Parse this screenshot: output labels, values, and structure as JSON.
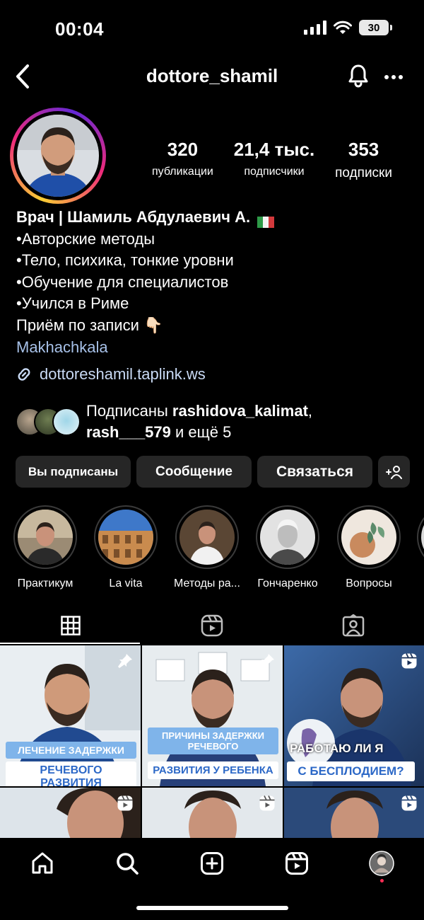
{
  "status_bar": {
    "time": "00:04",
    "battery": "30"
  },
  "header": {
    "username": "dottore_shamil"
  },
  "stats": {
    "posts": {
      "value": "320",
      "label": "публикации"
    },
    "followers": {
      "value": "21,4 тыс.",
      "label": "подписчики"
    },
    "following": {
      "value": "353",
      "label": "подписки"
    }
  },
  "bio": {
    "name": "Врач | Шамиль Абдулаевич А.",
    "lines": [
      "•Авторские методы",
      "•Тело, психика, тонкие уровни",
      "•Обучение для специалистов",
      "•Учился в Риме",
      "Приём по записи 👇🏻"
    ],
    "location": "Makhachkala",
    "link": "dottoreshamil.taplink.ws"
  },
  "followed_by": {
    "prefix": "Подписаны ",
    "user1": "rashidova_kalimat",
    "comma": ",",
    "user2": "rash___579",
    "suffix": " и ещё 5"
  },
  "buttons": {
    "following": "Вы подписаны",
    "message": "Сообщение",
    "contact": "Связаться",
    "add_user": "+👤"
  },
  "highlights": [
    {
      "label": "Практикум"
    },
    {
      "label": "La vita"
    },
    {
      "label": "Методы ра..."
    },
    {
      "label": "Гончаренко"
    },
    {
      "label": "Вопросы"
    }
  ],
  "grid": [
    {
      "top": "ЛЕЧЕНИЕ ЗАДЕРЖКИ",
      "bottom": "РЕЧЕВОГО РАЗВИТИЯ",
      "badge": "pin-icon"
    },
    {
      "top": "ПРИЧИНЫ ЗАДЕРЖКИ РЕЧЕВОГО",
      "bottom": "РАЗВИТИЯ У РЕБЕНКА",
      "badge": "pin-icon"
    },
    {
      "top": "РАБОТАЮ ЛИ Я",
      "bottom": "С БЕСПЛОДИЕМ?",
      "badge": "reels-icon"
    }
  ],
  "colors": {
    "background": "#000000",
    "button": "#262626",
    "link": "#c9daf5",
    "accent_blue": "#2c68c7"
  }
}
